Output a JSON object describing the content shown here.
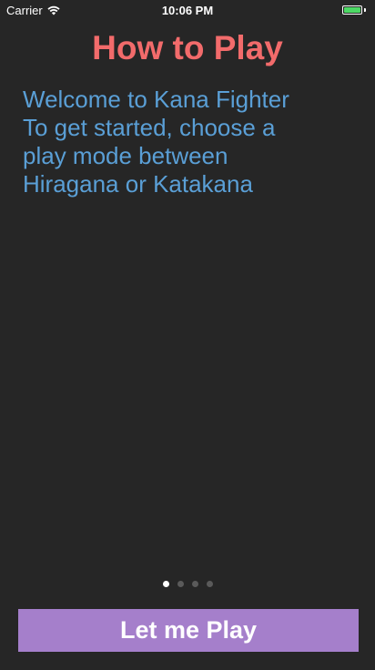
{
  "status_bar": {
    "carrier": "Carrier",
    "time": "10:06 PM",
    "wifi_icon": "wifi-icon",
    "battery_icon": "battery-charging-icon",
    "battery_level": 1.0
  },
  "title": "How to Play",
  "body_lines": [
    "Welcome to Kana Fighter",
    "To get started, choose a",
    "play mode between",
    "Hiragana or Katakana"
  ],
  "pager": {
    "total_pages": 4,
    "current_page": 1
  },
  "play_button_label": "Let me Play",
  "colors": {
    "background": "#262626",
    "title": "#f26b6b",
    "body_text": "#5a9fd6",
    "button": "#a57fcb",
    "battery": "#4cd964",
    "dot_active": "#ffffff",
    "dot_inactive": "#5a5a5a"
  }
}
